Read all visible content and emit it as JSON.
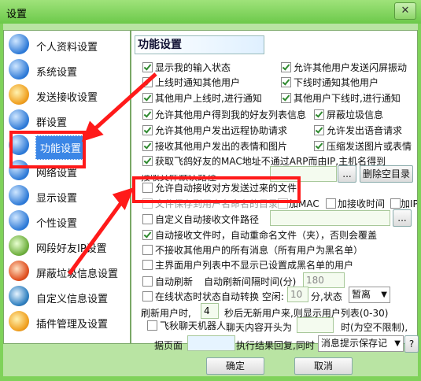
{
  "window": {
    "title": "设置",
    "close_glyph": "✕"
  },
  "sidebar": {
    "items": [
      {
        "label": "个人资料设置",
        "icon": "globe-icon",
        "color": "#2b78d6"
      },
      {
        "label": "系统设置",
        "icon": "globe-icon",
        "color": "#2b78d6"
      },
      {
        "label": "发送接收设置",
        "icon": "gear-icon",
        "color": "#f0a020"
      },
      {
        "label": "群设置",
        "icon": "globe-icon",
        "color": "#2b78d6"
      },
      {
        "label": "功能设置",
        "icon": "globe-icon",
        "color": "#2b78d6",
        "selected": true
      },
      {
        "label": "网络设置",
        "icon": "globe-icon",
        "color": "#2b78d6"
      },
      {
        "label": "显示设置",
        "icon": "globe-icon",
        "color": "#2b78d6"
      },
      {
        "label": "个性设置",
        "icon": "globe-icon",
        "color": "#2b78d6"
      },
      {
        "label": "网段好友IP设置",
        "icon": "swirl-icon",
        "color": "#70b040"
      },
      {
        "label": "屏蔽垃圾信息设置",
        "icon": "shield-icon",
        "color": "#e05020"
      },
      {
        "label": "自定义信息设置",
        "icon": "compass-icon",
        "color": "#3080c0"
      },
      {
        "label": "插件管理及设置",
        "icon": "gear-icon",
        "color": "#f0a020"
      }
    ]
  },
  "main": {
    "section_title": "功能设置",
    "checks": {
      "show_input": {
        "label": "显示我的输入状态",
        "checked": true
      },
      "allow_flash": {
        "label": "允许其他用户发送闪屏振动",
        "checked": true
      },
      "notify_online": {
        "label": "上线时通知其他用户",
        "checked": true
      },
      "notify_offline": {
        "label": "下线时通知其他用户",
        "checked": true
      },
      "other_online": {
        "label": "其他用户上线时,进行通知",
        "checked": true
      },
      "other_offline": {
        "label": "其他用户下线时,进行通知",
        "checked": true
      },
      "allow_list": {
        "label": "允许其他用户得到我的好友列表信息",
        "checked": true
      },
      "block_info": {
        "label": "屏蔽垃圾信息",
        "checked": true
      },
      "remote_help": {
        "label": "允许其他用户发出远程协助请求",
        "checked": true
      },
      "voice_req": {
        "label": "允许发出语音请求",
        "checked": true
      },
      "recv_emoji": {
        "label": "接收其他用户发出的表情和图片",
        "checked": true
      },
      "compress_img": {
        "label": "压缩发送图片或表情",
        "checked": true
      },
      "get_mac": {
        "label": "获取飞鸽好友的MAC地址不通过ARP而由IP,主机名得到",
        "checked": true
      },
      "allow_auto_recv": {
        "label": "允许自动接收对方发送过来的文件",
        "checked": false
      },
      "custom_recv_path": {
        "label": "自定义自动接收文件路径",
        "checked": false
      },
      "auto_rename": {
        "label": "自动接收文件时，自动重命名文件（夹），否则会覆盖",
        "checked": true
      },
      "no_msg": {
        "label": "不接收其他用户的所有消息（所有用户为黑名单）",
        "checked": false
      },
      "hide_black": {
        "label": "主界面用户列表中不显示已设置成黑名单的用户",
        "checked": false
      },
      "auto_refresh": {
        "label": "自动刷新",
        "checked": false
      },
      "auto_status": {
        "label": "在线状态时状态自动转换 空闲:",
        "checked": false
      },
      "bot": {
        "label": "飞秋聊天机器人",
        "checked": false
      }
    },
    "recv_path_label": "接收文件默认路径",
    "recv_path_browse": "...",
    "delete_all_btn": "删除空目录",
    "partial_1": "文件保存到用户名命名的目录",
    "add_mac": "加MAC",
    "add_recv_time": "加接收时间",
    "add_ip": "加IP",
    "custom_browse": "...",
    "refresh_interval_label": "自动刷新间隔时间(分)",
    "refresh_interval_value": "180",
    "idle_value": "10",
    "idle_unit": "分,状态",
    "status_value": "暂离",
    "refresh_user_label_a": "刷新用户时,",
    "refresh_user_value": "4",
    "refresh_user_label_b": "秒后无新用户来,则显示用户列表(0-30)",
    "bot_prefix_label": "聊天内容开头为",
    "bot_limit": "时(为空不限制),",
    "page_label": "据页面",
    "result_label": "执行结果回复,同时",
    "result_select": "消息提示保存记",
    "help_btn": "?"
  },
  "buttons": {
    "ok": "确定",
    "cancel": "取消"
  },
  "annotations": {
    "highlight_color": "#ff1a1a"
  }
}
